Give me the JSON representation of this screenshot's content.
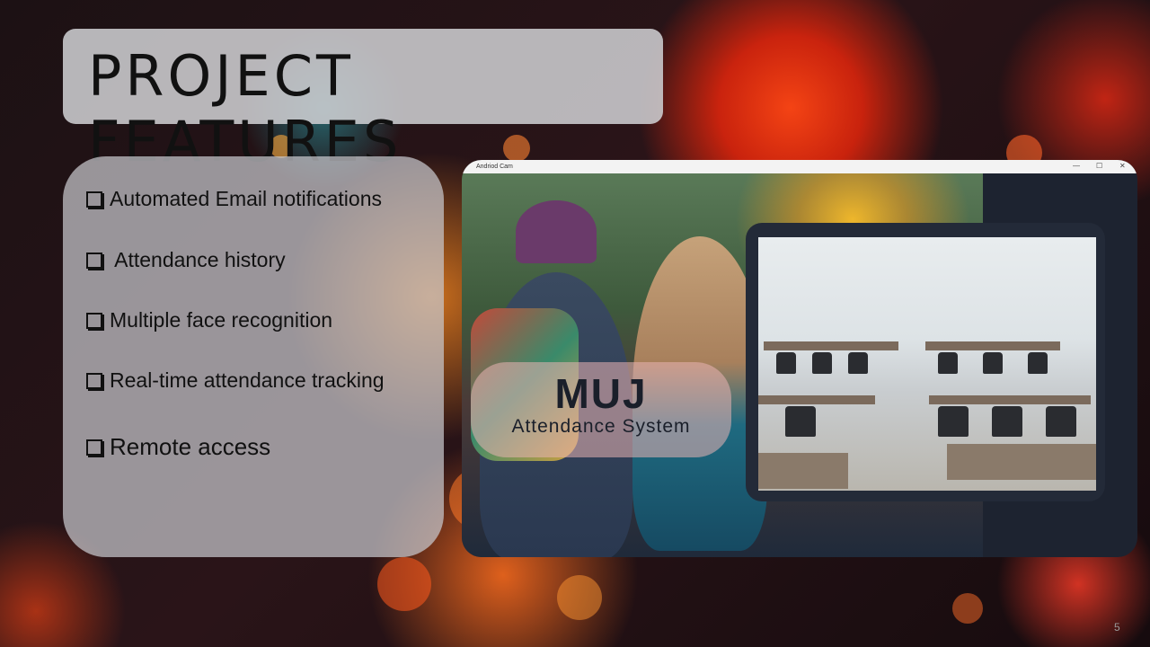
{
  "slide": {
    "title": "PROJECT FEATURES",
    "page_number": "5"
  },
  "features": [
    {
      "label": "Automated Email notifications"
    },
    {
      "label": " Attendance history"
    },
    {
      "label": "Multiple face recognition"
    },
    {
      "label": "Real-time attendance tracking"
    },
    {
      "label": "Remote access"
    }
  ],
  "app_window": {
    "title": "Andriod Cam",
    "minimize": "—",
    "maximize": "☐",
    "close": "✕",
    "overlay_title": "MUJ",
    "overlay_subtitle": "Attendance System"
  },
  "colors": {
    "accent_orange": "#ff4a14",
    "panel_gray": "#c8c8cd",
    "window_dark": "#1d2330"
  }
}
